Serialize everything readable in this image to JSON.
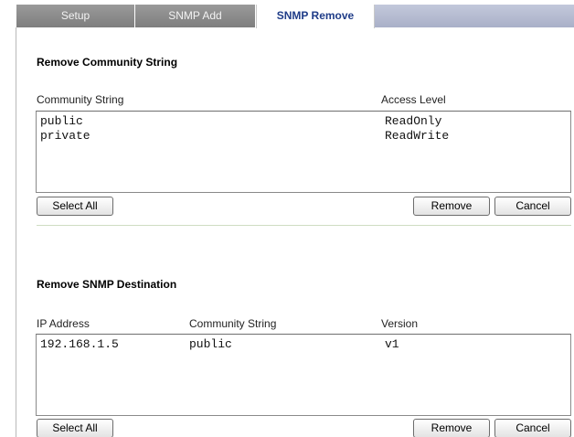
{
  "tabs": [
    {
      "label": "Setup",
      "active": false
    },
    {
      "label": "SNMP Add",
      "active": false
    },
    {
      "label": "SNMP Remove",
      "active": true
    }
  ],
  "community_section": {
    "title": "Remove Community String",
    "columns": [
      "Community String",
      "Access Level"
    ],
    "rows": [
      {
        "community": "public",
        "access": "ReadOnly"
      },
      {
        "community": "private",
        "access": "ReadWrite"
      }
    ],
    "select_all_label": "Select All",
    "remove_label": "Remove",
    "cancel_label": "Cancel"
  },
  "destination_section": {
    "title": "Remove SNMP Destination",
    "columns": [
      "IP Address",
      "Community String",
      "Version"
    ],
    "rows": [
      {
        "ip": "192.168.1.5",
        "community": "public",
        "version": "v1"
      }
    ],
    "select_all_label": "Select All",
    "remove_label": "Remove",
    "cancel_label": "Cancel"
  },
  "colors": {
    "active_tab_text": "#1f3c88",
    "inactive_tab_bg": "#8c8c8c",
    "tabbar_bg": "#b6bcd2"
  }
}
